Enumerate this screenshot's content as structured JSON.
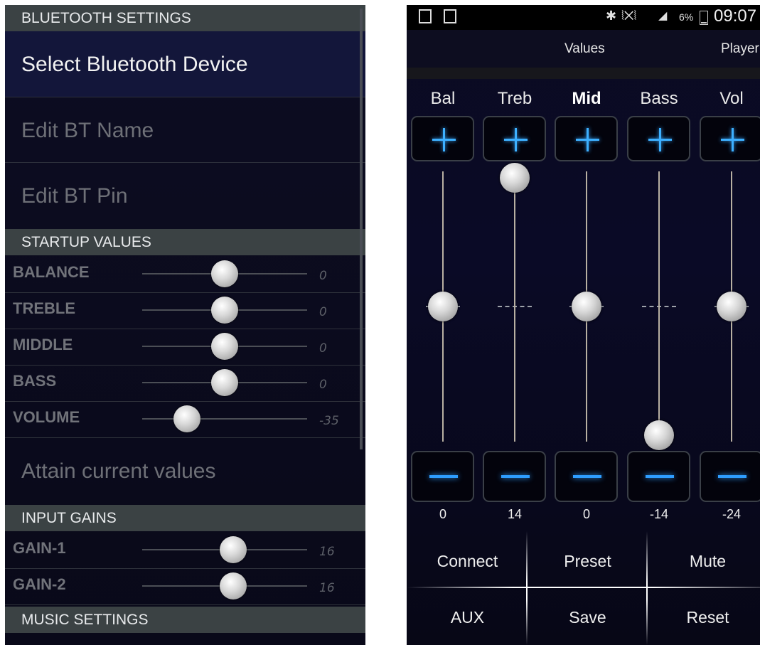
{
  "left_panel": {
    "bt_header": "BLUETOOTH SETTINGS",
    "select_device": "Select Bluetooth Device",
    "edit_name": "Edit BT Name",
    "edit_pin": "Edit BT Pin",
    "startup_header": "STARTUP VALUES",
    "startup_sliders": [
      {
        "label": "BALANCE",
        "value": "0",
        "position": 0.5
      },
      {
        "label": "TREBLE",
        "value": "0",
        "position": 0.5
      },
      {
        "label": "MIDDLE",
        "value": "0",
        "position": 0.5
      },
      {
        "label": "BASS",
        "value": "0",
        "position": 0.5
      },
      {
        "label": "VOLUME",
        "value": "-35",
        "position": 0.27
      }
    ],
    "attain_current": "Attain current values",
    "gains_header": "INPUT GAINS",
    "gain_sliders": [
      {
        "label": "GAIN-1",
        "value": "16",
        "position": 0.55
      },
      {
        "label": "GAIN-2",
        "value": "16",
        "position": 0.55
      }
    ],
    "music_header": "MUSIC SETTINGS"
  },
  "right_panel": {
    "status": {
      "battery": "6%",
      "time": "09:07"
    },
    "tabs": {
      "active": "Values",
      "next": "Player"
    },
    "channels": [
      {
        "label": "Bal",
        "value": "0",
        "level": 0.5,
        "bold": false
      },
      {
        "label": "Treb",
        "value": "14",
        "level": 1.0,
        "bold": false
      },
      {
        "label": "Mid",
        "value": "0",
        "level": 0.5,
        "bold": true
      },
      {
        "label": "Bass",
        "value": "-14",
        "level": 0.0,
        "bold": false
      },
      {
        "label": "Vol",
        "value": "-24",
        "level": 0.5,
        "bold": false
      }
    ],
    "buttons": {
      "connect": "Connect",
      "preset": "Preset",
      "mute": "Mute",
      "aux": "AUX",
      "save": "Save",
      "reset": "Reset"
    }
  },
  "colors": {
    "accent_blue": "#2a8be0",
    "header_gray": "#3b4244",
    "background": "#0a0a1e"
  },
  "icons": [
    "screenshot-icon",
    "gallery-icon",
    "bluetooth-icon",
    "vibrate-icon",
    "signal-icon",
    "battery-icon",
    "plus-icon",
    "minus-icon"
  ]
}
